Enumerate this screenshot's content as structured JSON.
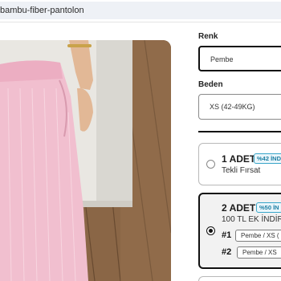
{
  "browser": {
    "url": "bambu-fiber-pantolon"
  },
  "product": {
    "image_alt": "Pembe bambu fiber pantolon"
  },
  "options": {
    "color_label": "Renk",
    "color_value": "Pembe",
    "size_label": "Beden",
    "size_value": "XS (42-49KG)"
  },
  "offers": [
    {
      "title": "1 ADET",
      "badge": "%42 İND",
      "subtitle": "Tekli Fırsat",
      "selected": false
    },
    {
      "title": "2 ADET",
      "badge": "%50 İN",
      "subtitle": "100 TL EK İNDİRİ",
      "selected": true,
      "items": [
        {
          "num": "#1",
          "value": "Pembe / XS ("
        },
        {
          "num": "#2",
          "value": "Pembe / XS"
        }
      ]
    }
  ],
  "colors": {
    "accent_badge": "#3aa6c9",
    "selected_border": "#111111"
  }
}
